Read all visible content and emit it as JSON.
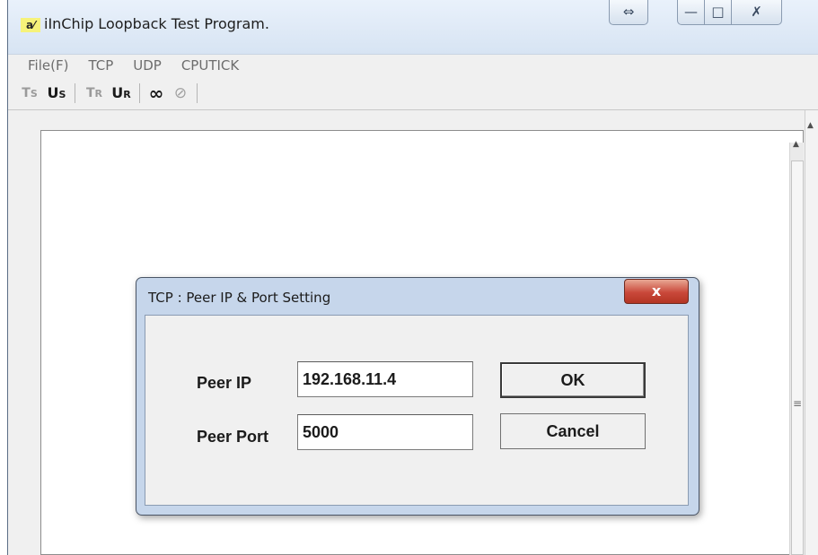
{
  "window": {
    "title": "iInChip Loopback Test Program.",
    "app_icon_text": "a⁄",
    "resize_glyph": "⇔",
    "min_glyph": "—",
    "max_glyph": "□",
    "close_glyph": "✗"
  },
  "menubar": {
    "items": [
      "File(F)",
      "TCP",
      "UDP",
      "CPUTICK"
    ]
  },
  "toolbar": {
    "buttons": [
      {
        "icon": "tcp-send-icon",
        "label": "TS"
      },
      {
        "icon": "udp-send-icon",
        "label": "US"
      },
      {
        "icon": "tcp-recv-icon",
        "label": "TR"
      },
      {
        "icon": "udp-recv-icon",
        "label": "UR"
      },
      {
        "icon": "infinity-icon",
        "label": "∞"
      },
      {
        "icon": "stop-icon",
        "label": "⊘"
      }
    ]
  },
  "dialog": {
    "title": "TCP : Peer IP & Port Setting",
    "close_glyph": "x",
    "peer_ip_label": "Peer IP",
    "peer_ip_value": "192.168.11.4",
    "peer_port_label": "Peer Port",
    "peer_port_value": "5000",
    "ok_label": "OK",
    "cancel_label": "Cancel"
  }
}
